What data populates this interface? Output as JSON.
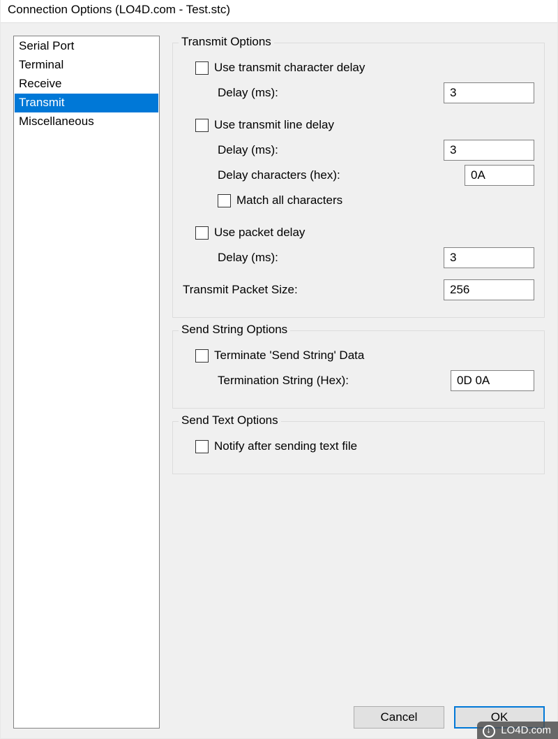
{
  "window": {
    "title": "Connection Options (LO4D.com - Test.stc)"
  },
  "sidebar": {
    "items": [
      {
        "label": "Serial Port",
        "selected": false
      },
      {
        "label": "Terminal",
        "selected": false
      },
      {
        "label": "Receive",
        "selected": false
      },
      {
        "label": "Transmit",
        "selected": true
      },
      {
        "label": "Miscellaneous",
        "selected": false
      }
    ]
  },
  "transmitOptions": {
    "title": "Transmit Options",
    "useCharDelay": {
      "label": "Use transmit character delay",
      "checked": false
    },
    "charDelayLabel": "Delay (ms):",
    "charDelayValue": "3",
    "useLineDelay": {
      "label": "Use transmit line delay",
      "checked": false
    },
    "lineDelayLabel": "Delay (ms):",
    "lineDelayValue": "3",
    "delayCharsLabel": "Delay characters (hex):",
    "delayCharsValue": "0A",
    "matchAll": {
      "label": "Match all characters",
      "checked": false
    },
    "usePacketDelay": {
      "label": "Use packet delay",
      "checked": false
    },
    "packetDelayLabel": "Delay (ms):",
    "packetDelayValue": "3",
    "packetSizeLabel": "Transmit Packet Size:",
    "packetSizeValue": "256"
  },
  "sendString": {
    "title": "Send String Options",
    "terminate": {
      "label": "Terminate 'Send String' Data",
      "checked": false
    },
    "terminationLabel": "Termination String (Hex):",
    "terminationValue": "0D 0A"
  },
  "sendText": {
    "title": "Send Text Options",
    "notify": {
      "label": "Notify after sending text file",
      "checked": false
    }
  },
  "buttons": {
    "cancel": "Cancel",
    "ok": "OK"
  },
  "watermark": "LO4D.com"
}
